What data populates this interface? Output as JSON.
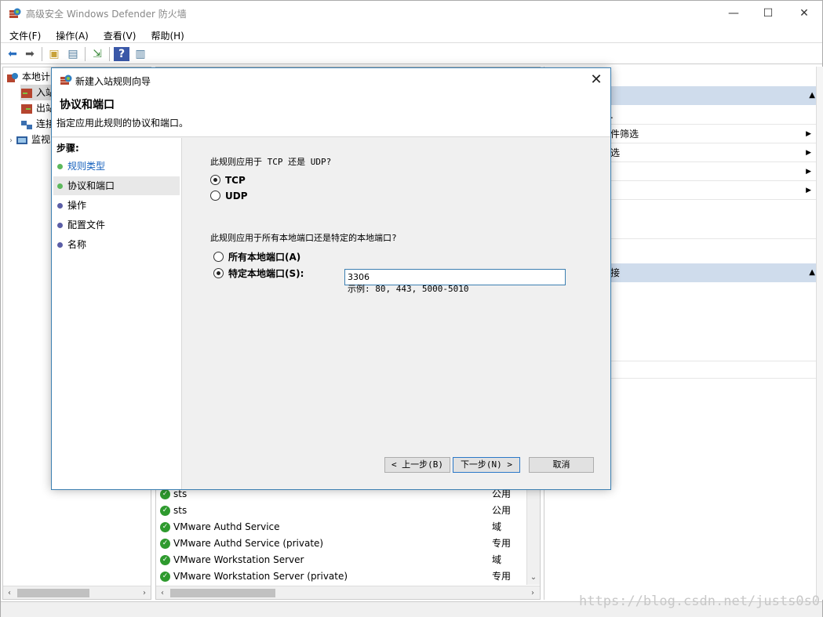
{
  "window": {
    "title": "高级安全 Windows Defender 防火墙",
    "minimize": "—",
    "maximize": "☐",
    "close": "✕"
  },
  "menu": [
    "文件(F)",
    "操作(A)",
    "查看(V)",
    "帮助(H)"
  ],
  "tree": [
    {
      "label": "本地计",
      "icon": "firewall-icon"
    },
    {
      "label": "入站",
      "icon": "inbound-rules-icon"
    },
    {
      "label": "出站",
      "icon": "outbound-rules-icon"
    },
    {
      "label": "连接",
      "icon": "connection-security-icon"
    },
    {
      "label": "监视",
      "icon": "monitoring-icon"
    }
  ],
  "rules": [
    {
      "name": "sts",
      "profile": "公用"
    },
    {
      "name": "sts",
      "profile": "公用"
    },
    {
      "name": "VMware Authd Service",
      "profile": "域"
    },
    {
      "name": "VMware Authd Service (private)",
      "profile": "专用"
    },
    {
      "name": "VMware Workstation Server",
      "profile": "域"
    },
    {
      "name": "VMware Workstation Server (private)",
      "profile": "专用"
    }
  ],
  "actions": {
    "section1_items": [
      "件筛选",
      "选",
      "",
      ""
    ],
    "section1_extra": [
      "."
    ],
    "section2_header": "接"
  },
  "dialog": {
    "title": "新建入站规则向导",
    "heading": "协议和端口",
    "subtitle": "指定应用此规则的协议和端口。",
    "steps_title": "步骤:",
    "steps": [
      "规则类型",
      "协议和端口",
      "操作",
      "配置文件",
      "名称"
    ],
    "protocol_question": "此规则应用于 TCP 还是 UDP?",
    "tcp_label": "TCP",
    "udp_label": "UDP",
    "port_question": "此规则应用于所有本地端口还是特定的本地端口?",
    "all_ports_label": "所有本地端口(A)",
    "specific_ports_label": "特定本地端口(S):",
    "port_value": "3306",
    "example": "示例: 80, 443, 5000-5010",
    "back_button": "< 上一步(B)",
    "next_button": "下一步(N) >",
    "cancel_button": "取消"
  },
  "watermark": "https://blog.csdn.net/justs0s0",
  "colors": {
    "accent": "#3c7fb1",
    "action_header": "#cfdcec",
    "ok_green": "#2e9a2e",
    "step_dot_green": "#5cb85c",
    "step_dot_purple": "#5b5ea6"
  }
}
